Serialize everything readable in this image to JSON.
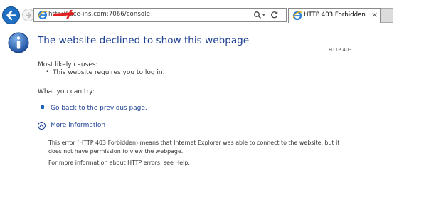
{
  "browser": {
    "address_url": "http://                 ace-ins.com:7066/console",
    "tab_title": "HTTP 403 Forbidden",
    "tab_close": "×",
    "search_dropdown": "▾"
  },
  "page": {
    "heading": "The website declined to show this webpage",
    "error_code": "HTTP 403",
    "causes_label": "Most likely causes:",
    "causes": [
      "This website requires you to log in."
    ],
    "try_label": "What you can try:",
    "go_back_link": "Go back to the previous page.",
    "more_info_label": "More information",
    "detail_text": "This error (HTTP 403 Forbidden) means that Internet Explorer was able to connect to the website, but it does not have permission to view the webpage.",
    "help_text": "For more information about HTTP errors, see Help."
  },
  "colors": {
    "accent_blue": "#1c3f94",
    "redaction_red": "#e02020"
  },
  "icons": {
    "back": "back-arrow-icon",
    "forward": "forward-arrow-icon",
    "ie": "internet-explorer-icon",
    "search": "search-icon",
    "refresh": "refresh-icon",
    "info": "info-icon",
    "expand": "expand-chevron-icon"
  }
}
